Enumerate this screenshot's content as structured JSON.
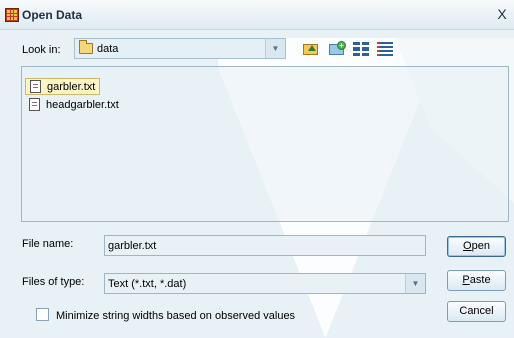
{
  "window": {
    "title": "Open Data",
    "close_glyph": "X"
  },
  "look_in": {
    "label": "Look in:",
    "value": "data",
    "icon": "folder-icon"
  },
  "toolbar": {
    "icons": [
      "up-folder-icon",
      "new-folder-icon",
      "list-view-icon",
      "details-view-icon"
    ]
  },
  "files": [
    {
      "name": "garbler.txt",
      "selected": true
    },
    {
      "name": "headgarbler.txt",
      "selected": false
    }
  ],
  "file_name": {
    "label": "File name:",
    "value": "garbler.txt"
  },
  "files_of_type": {
    "label": "Files of type:",
    "value": "Text (*.txt, *.dat)"
  },
  "buttons": {
    "open": {
      "first": "O",
      "rest": "pen"
    },
    "paste": {
      "first": "P",
      "rest": "aste"
    },
    "cancel": "Cancel"
  },
  "minimize": {
    "label": "Minimize string widths based on observed values",
    "checked": false
  }
}
